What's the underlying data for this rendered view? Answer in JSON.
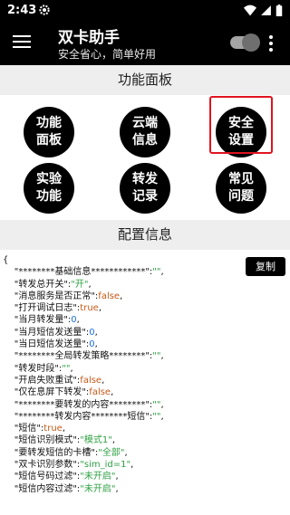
{
  "status_bar": {
    "time": "2:43",
    "icons": [
      "gear-icon",
      "wifi-icon",
      "cellular-icon",
      "battery-icon"
    ]
  },
  "app_bar": {
    "title": "双卡助手",
    "subtitle": "安全省心，简单好用",
    "toggle_on": true
  },
  "panel": {
    "header": "功能面板",
    "buttons": [
      {
        "label": "功能\n面板"
      },
      {
        "label": "云端\n信息"
      },
      {
        "label": "安全\n设置"
      },
      {
        "label": "实验\n功能"
      },
      {
        "label": "转发\n记录"
      },
      {
        "label": "常见\n问题"
      }
    ]
  },
  "config": {
    "header": "配置信息",
    "copy_label": "复制",
    "json_lines": [
      [
        {
          "t": "{",
          "c": "k"
        }
      ],
      [
        {
          "t": "    \"********基础信息************\"",
          "c": "k"
        },
        {
          "t": ":",
          "c": "k"
        },
        {
          "t": "\"\"",
          "c": "s"
        },
        {
          "t": ",",
          "c": "k"
        }
      ],
      [
        {
          "t": "    \"转发总开关\"",
          "c": "k"
        },
        {
          "t": ":",
          "c": "k"
        },
        {
          "t": "\"开\"",
          "c": "s"
        },
        {
          "t": ",",
          "c": "k"
        }
      ],
      [
        {
          "t": "    \"消息服务是否正常\"",
          "c": "k"
        },
        {
          "t": ":",
          "c": "k"
        },
        {
          "t": "false",
          "c": "b"
        },
        {
          "t": ",",
          "c": "k"
        }
      ],
      [
        {
          "t": "    \"打开调试日志\"",
          "c": "k"
        },
        {
          "t": ":",
          "c": "k"
        },
        {
          "t": "true",
          "c": "b"
        },
        {
          "t": ",",
          "c": "k"
        }
      ],
      [
        {
          "t": "    \"当月转发量\"",
          "c": "k"
        },
        {
          "t": ":",
          "c": "k"
        },
        {
          "t": "0",
          "c": "n"
        },
        {
          "t": ",",
          "c": "k"
        }
      ],
      [
        {
          "t": "    \"当月短信发送量\"",
          "c": "k"
        },
        {
          "t": ":",
          "c": "k"
        },
        {
          "t": "0",
          "c": "n"
        },
        {
          "t": ",",
          "c": "k"
        }
      ],
      [
        {
          "t": "    \"当日短信发送量\"",
          "c": "k"
        },
        {
          "t": ":",
          "c": "k"
        },
        {
          "t": "0",
          "c": "n"
        },
        {
          "t": ",",
          "c": "k"
        }
      ],
      [
        {
          "t": "    \"********全局转发策略********\"",
          "c": "k"
        },
        {
          "t": ":",
          "c": "k"
        },
        {
          "t": "\"\"",
          "c": "s"
        },
        {
          "t": ",",
          "c": "k"
        }
      ],
      [
        {
          "t": "    \"转发时段\"",
          "c": "k"
        },
        {
          "t": ":",
          "c": "k"
        },
        {
          "t": "\"\"",
          "c": "s"
        },
        {
          "t": ",",
          "c": "k"
        }
      ],
      [
        {
          "t": "    \"开启失败重试\"",
          "c": "k"
        },
        {
          "t": ":",
          "c": "k"
        },
        {
          "t": "false",
          "c": "b"
        },
        {
          "t": ",",
          "c": "k"
        }
      ],
      [
        {
          "t": "    \"仅在息屏下转发\"",
          "c": "k"
        },
        {
          "t": ":",
          "c": "k"
        },
        {
          "t": "false",
          "c": "b"
        },
        {
          "t": ",",
          "c": "k"
        }
      ],
      [
        {
          "t": "    \"********要转发的内容********\"",
          "c": "k"
        },
        {
          "t": ":",
          "c": "k"
        },
        {
          "t": "\"\"",
          "c": "s"
        },
        {
          "t": ",",
          "c": "k"
        }
      ],
      [
        {
          "t": "    \"********转发内容********短信\"",
          "c": "k"
        },
        {
          "t": ":",
          "c": "k"
        },
        {
          "t": "\"\"",
          "c": "s"
        },
        {
          "t": ",",
          "c": "k"
        }
      ],
      [
        {
          "t": "    \"短信\"",
          "c": "k"
        },
        {
          "t": ":",
          "c": "k"
        },
        {
          "t": "true",
          "c": "b"
        },
        {
          "t": ",",
          "c": "k"
        }
      ],
      [
        {
          "t": "    \"短信识别模式\"",
          "c": "k"
        },
        {
          "t": ":",
          "c": "k"
        },
        {
          "t": "\"模式1\"",
          "c": "s"
        },
        {
          "t": ",",
          "c": "k"
        }
      ],
      [
        {
          "t": "    \"要转发短信的卡槽\"",
          "c": "k"
        },
        {
          "t": ":",
          "c": "k"
        },
        {
          "t": "\"全部\"",
          "c": "s"
        },
        {
          "t": ",",
          "c": "k"
        }
      ],
      [
        {
          "t": "    \"双卡识别参数\"",
          "c": "k"
        },
        {
          "t": ":",
          "c": "k"
        },
        {
          "t": "\"sim_id=1\"",
          "c": "s"
        },
        {
          "t": ",",
          "c": "k"
        }
      ],
      [
        {
          "t": "    \"短信号码过滤\"",
          "c": "k"
        },
        {
          "t": ":",
          "c": "k"
        },
        {
          "t": "\"未开启\"",
          "c": "s"
        },
        {
          "t": ",",
          "c": "k"
        }
      ],
      [
        {
          "t": "    \"短信内容过滤\"",
          "c": "k"
        },
        {
          "t": ":",
          "c": "k"
        },
        {
          "t": "\"未开启\"",
          "c": "s"
        },
        {
          "t": ",",
          "c": "k"
        }
      ]
    ]
  },
  "colors": {
    "key": "#111111",
    "string": "#2ea043",
    "boolean": "#c65a18",
    "number": "#1b6fd6",
    "highlight": "#e0141e"
  }
}
